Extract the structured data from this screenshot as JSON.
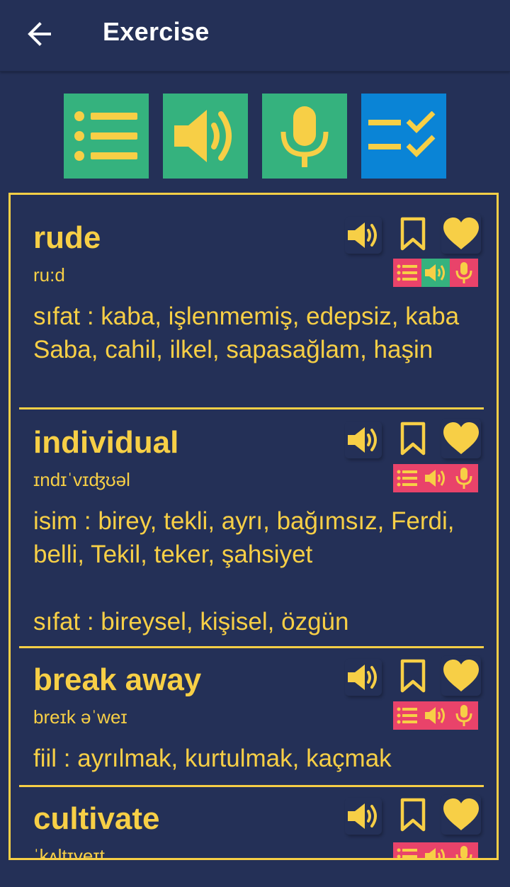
{
  "header": {
    "title": "Exercise"
  },
  "modes": [
    {
      "icon": "list-icon",
      "color": "#35b27e"
    },
    {
      "icon": "speaker-icon",
      "color": "#35b27e"
    },
    {
      "icon": "microphone-icon",
      "color": "#35b27e"
    },
    {
      "icon": "checklist-icon",
      "color": "#0a84d6"
    }
  ],
  "theme": {
    "background": "#243057",
    "accent": "#f7cf46",
    "badge_red": "#e9436a",
    "badge_green": "#35b27e"
  },
  "words": [
    {
      "word": "rude",
      "ipa": "ru:d",
      "meanings": [
        "sıfat : kaba, işlenmemiş, edepsiz, kaba Saba, cahil, ilkel, sapasağlam, haşin"
      ],
      "badges": [
        "red",
        "green",
        "red"
      ]
    },
    {
      "word": "individual",
      "ipa": "ɪndɪˈvɪʤʊəl",
      "meanings": [
        "isim : birey, tekli, ayrı, bağımsız, Ferdi, belli, Tekil, teker, şahsiyet",
        "sıfat : bireysel, kişisel, özgün"
      ],
      "badges": [
        "red",
        "red",
        "red"
      ]
    },
    {
      "word": "break away",
      "ipa": "breɪk əˈweɪ",
      "meanings": [
        "fiil : ayrılmak, kurtulmak, kaçmak"
      ],
      "badges": [
        "red",
        "red",
        "red"
      ]
    },
    {
      "word": "cultivate",
      "ipa": "ˈkʌltɪveɪt",
      "meanings": [],
      "badges": [
        "red",
        "red",
        "red"
      ]
    }
  ]
}
